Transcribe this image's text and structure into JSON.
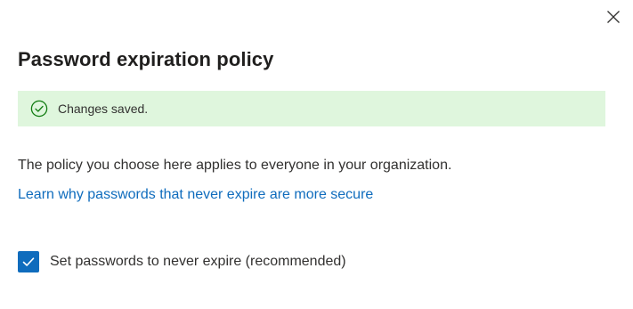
{
  "dialog": {
    "title": "Password expiration policy",
    "close_icon": "close-icon"
  },
  "banner": {
    "icon": "checkmark-circle-icon",
    "message": "Changes saved.",
    "background_color": "#dff6dd",
    "icon_color": "#107c10"
  },
  "content": {
    "description": "The policy you choose here applies to everyone in your organization.",
    "learn_link": "Learn why passwords that never expire are more secure",
    "link_color": "#0f6cbd"
  },
  "option": {
    "label": "Set passwords to never expire (recommended)",
    "checked": true,
    "icon": "checkmark-icon"
  }
}
